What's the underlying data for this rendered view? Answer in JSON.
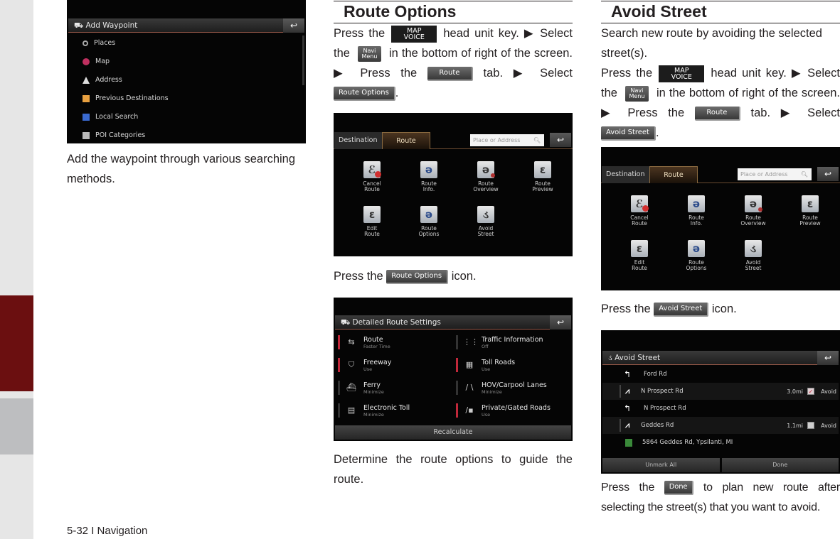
{
  "page": {
    "footer": "5-32 I Navigation",
    "colors": {
      "side_strip": "#e6e6e6",
      "side_tab_active": "#6b0f10",
      "side_tab_inactive": "#bdbec0",
      "text": "#231f20"
    }
  },
  "col1": {
    "screen_waypoint": {
      "header": "Add Waypoint",
      "back_icon": "back-arrow-icon",
      "items": [
        {
          "label": "Places",
          "icon": "magnifier-icon"
        },
        {
          "label": "Map",
          "icon": "map-pin-icon"
        },
        {
          "label": "Address",
          "icon": "house-icon"
        },
        {
          "label": "Previous Destinations",
          "icon": "folder-icon"
        },
        {
          "label": "Local Search",
          "icon": "local-search-icon"
        },
        {
          "label": "POI Categories",
          "icon": "poi-building-icon"
        }
      ]
    },
    "caption": "Add the waypoint through various searching methods."
  },
  "col2": {
    "title": "Route Options",
    "intro": {
      "t1": "Press the",
      "key_map_line1": "MAP",
      "key_map_line2": "VOICE",
      "t2": "head unit key. ▶ Select the",
      "key_navi_line1": "Navi",
      "key_navi_line2": "Menu",
      "t3": "in the bottom of right of the screen. ▶ Press the",
      "key_route": "Route",
      "t4": "tab. ▶ Select",
      "key_select": "Route Options",
      "t5": "."
    },
    "screen_route": {
      "tab_destination": "Destination",
      "tab_route": "Route",
      "search_placeholder": "Place or Address",
      "icons": [
        {
          "line1": "Cancel",
          "line2": "Route"
        },
        {
          "line1": "Route",
          "line2": "Info."
        },
        {
          "line1": "Route",
          "line2": "Overview"
        },
        {
          "line1": "Route",
          "line2": "Preview"
        },
        {
          "line1": "Edit",
          "line2": "Route"
        },
        {
          "line1": "Route",
          "line2": "Options"
        },
        {
          "line1": "Avoid",
          "line2": "Street"
        }
      ]
    },
    "press_icon": {
      "t1": "Press the",
      "key": "Route Options",
      "t2": "icon."
    },
    "screen_settings": {
      "header": "Detailed Route Settings",
      "items": [
        {
          "title": "Route",
          "sub": "Faster Time",
          "active": true
        },
        {
          "title": "Traffic Information",
          "sub": "Off",
          "active": false
        },
        {
          "title": "Freeway",
          "sub": "Use",
          "active": true
        },
        {
          "title": "Toll Roads",
          "sub": "Use",
          "active": true
        },
        {
          "title": "Ferry",
          "sub": "Minimize",
          "active": false
        },
        {
          "title": "HOV/Carpool Lanes",
          "sub": "Minimize",
          "active": false
        },
        {
          "title": "Electronic Toll",
          "sub": "Minimize",
          "active": false
        },
        {
          "title": "Private/Gated Roads",
          "sub": "Use",
          "active": true
        }
      ],
      "recalculate": "Recalculate"
    },
    "caption": "Determine the route options to guide the route."
  },
  "col3": {
    "title": "Avoid Street",
    "desc": "Search new route by avoiding the selected street(s).",
    "intro": {
      "t1": "Press the",
      "key_map_line1": "MAP",
      "key_map_line2": "VOICE",
      "t2": "head unit key. ▶ Select the",
      "key_navi_line1": "Navi",
      "key_navi_line2": "Menu",
      "t3": "in the bottom of right of the screen. ▶ Press the",
      "key_route": "Route",
      "t4": "tab. ▶ Select",
      "key_select": "Avoid Street",
      "t5": "."
    },
    "press_icon": {
      "t1": "Press the",
      "key": "Avoid Street",
      "t2": "icon."
    },
    "screen_avoid": {
      "header": "Avoid Street",
      "rows": [
        {
          "type": "turn",
          "name": "Ford Rd"
        },
        {
          "type": "road",
          "name": "N Prospect Rd",
          "dist": "3.0mi",
          "checked": true,
          "avoid": "Avoid"
        },
        {
          "type": "turn",
          "name": "N Prospect Rd"
        },
        {
          "type": "road",
          "name": "Geddes Rd",
          "dist": "1.1mi",
          "checked": false,
          "avoid": "Avoid"
        },
        {
          "type": "dest",
          "name": "5864 Geddes Rd, Ypsilanti, MI"
        }
      ],
      "btn_unmark": "Unmark All",
      "btn_done": "Done"
    },
    "done_text": {
      "t1": "Press the",
      "key": "Done",
      "t2": "to plan new route after selecting the street(s) that you want to avoid."
    }
  }
}
